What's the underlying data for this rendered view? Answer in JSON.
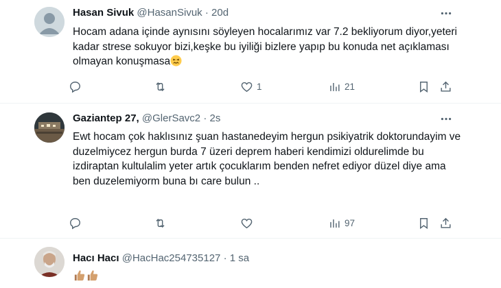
{
  "tweets": [
    {
      "name": "Hasan Sivuk",
      "handle": "@HasanSivuk",
      "sep": "·",
      "time": "20d",
      "text": "Hocam adana içinde aynısını söyleyen hocalarımız var 7.2 bekliyorum diyor,yeteri kadar strese sokuyor bizi,keşke bu iyiliği bizlere  yapıp bu konuda net açıklaması olmayan konuşmasa",
      "text_emoji": "confounded-face",
      "replies": "",
      "retweets": "",
      "likes": "1",
      "views": "21"
    },
    {
      "name": "Gaziantep 27,",
      "handle": "@GlerSavc2",
      "sep": "·",
      "time": "2s",
      "text": "Ewt hocam çok haklısınız şuan hastanedeyim hergun psikiyatrik doktorundayim ve duzelmiycez hergun burda 7 üzeri deprem haberi kendimizi oldurelimde bu izdiraptan kultulalim yeter artık  çocuklarım benden nefret ediyor düzel diye ama ben duzelemiyorm buna bı care bulun ..",
      "replies": "",
      "retweets": "",
      "likes": "",
      "views": "97"
    },
    {
      "name": "Hacı Hacı",
      "handle": "@HacHac254735127",
      "sep": "·",
      "time": "1 sa",
      "text_emoji": "thumbs-up-medium-skin x2"
    }
  ],
  "colors": {
    "text": "#0f1419",
    "muted": "#536471",
    "divider": "#eff3f4"
  },
  "icons": [
    "reply-icon",
    "retweet-icon",
    "like-icon",
    "views-icon",
    "bookmark-icon",
    "share-icon",
    "more-icon"
  ]
}
